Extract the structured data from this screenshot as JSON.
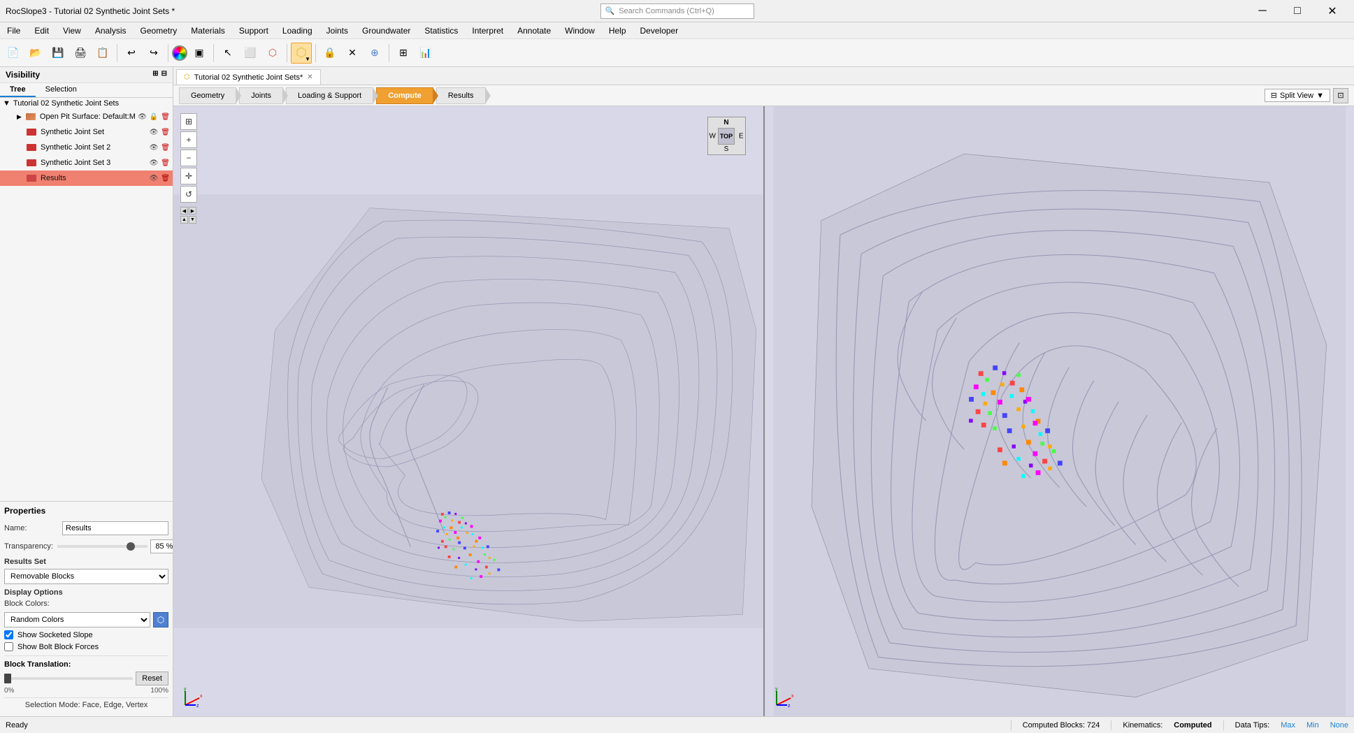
{
  "window": {
    "title": "RocSlope3 - Tutorial 02 Synthetic Joint Sets *",
    "search_placeholder": "Search Commands (Ctrl+Q)"
  },
  "menu": {
    "items": [
      "File",
      "Edit",
      "View",
      "Analysis",
      "Geometry",
      "Materials",
      "Support",
      "Loading",
      "Joints",
      "Groundwater",
      "Statistics",
      "Interpret",
      "Annotate",
      "Window",
      "Help",
      "Developer"
    ]
  },
  "tabs": {
    "active_tab": "Tutorial 02 Synthetic Joint Sets*"
  },
  "workflow": {
    "steps": [
      "Geometry",
      "Joints",
      "Loading & Support",
      "Compute",
      "Results"
    ],
    "active": "Compute"
  },
  "viewport": {
    "split_view_label": "Split View",
    "compass": {
      "n": "N",
      "s": "S",
      "e": "E",
      "w": "W",
      "center": "TOP"
    }
  },
  "visibility": {
    "title": "Visibility",
    "tabs": [
      "Tree",
      "Selection"
    ],
    "active_tab": "Tree",
    "group_title": "Tutorial 02 Synthetic Joint Sets",
    "items": [
      {
        "label": "Open Pit Surface: Default:Mesh_rep",
        "icon": "mesh-icon",
        "visible": true,
        "locked": true,
        "deletable": true,
        "indent": 1
      },
      {
        "label": "Synthetic Joint Set",
        "icon": "joints-icon",
        "visible": true,
        "deletable": true,
        "indent": 2
      },
      {
        "label": "Synthetic Joint Set 2",
        "icon": "joints-icon",
        "visible": true,
        "deletable": true,
        "indent": 2
      },
      {
        "label": "Synthetic Joint Set 3",
        "icon": "joints-icon",
        "visible": true,
        "deletable": true,
        "indent": 2
      },
      {
        "label": "Results",
        "icon": "results-icon",
        "visible": true,
        "deletable": true,
        "selected": true,
        "indent": 2
      }
    ]
  },
  "properties": {
    "title": "Properties",
    "name_label": "Name:",
    "name_value": "Results",
    "transparency_label": "Transparency:",
    "transparency_value": "85 %",
    "transparency_percent": 85,
    "results_set_label": "Results Set",
    "results_set_value": "Removable Blocks",
    "display_options_label": "Display Options",
    "block_colors_label": "Block Colors:",
    "block_colors_value": "Random Colors",
    "show_socketed_slope_label": "Show Socketed Slope",
    "show_socketed_slope_checked": true,
    "show_bolt_forces_label": "Show Bolt Block Forces",
    "show_bolt_forces_checked": false,
    "block_translation_label": "Block Translation:",
    "block_translation_value": 0,
    "reset_label": "Reset",
    "translation_min": "0%",
    "translation_max": "100%",
    "selection_mode": "Selection Mode: Face, Edge, Vertex"
  },
  "statusbar": {
    "ready": "Ready",
    "computed_blocks": "Computed Blocks: 724",
    "kinematics_label": "Kinematics:",
    "kinematics_value": "Computed",
    "data_tips_label": "Data Tips:",
    "data_tips_value": "Max",
    "max_label": "Max",
    "min_label": "Min",
    "none_label": "None"
  }
}
